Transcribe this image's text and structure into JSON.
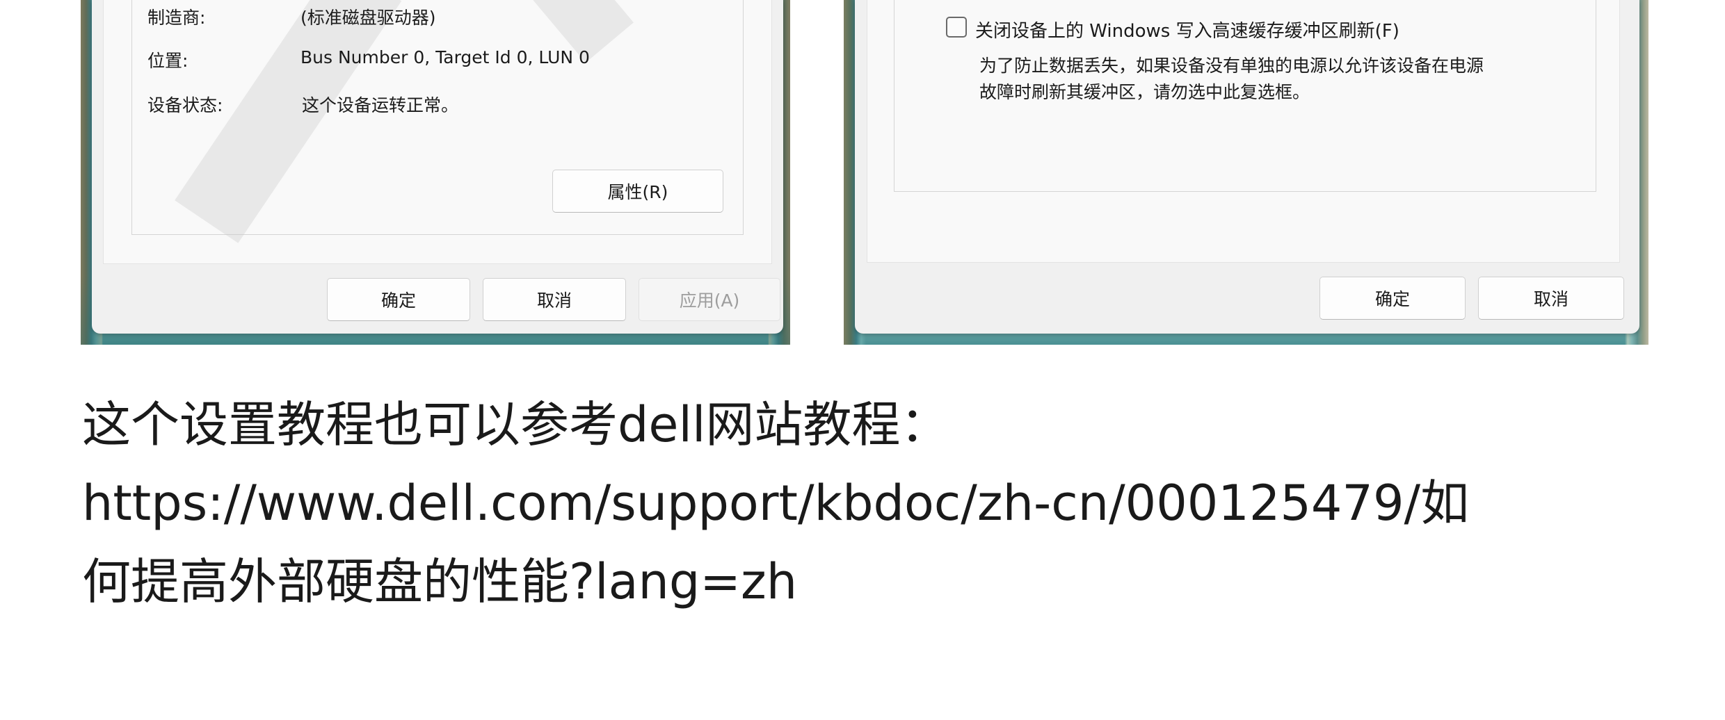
{
  "left_dialog": {
    "rows": [
      {
        "label": "制造商:",
        "value": "(标准磁盘驱动器)"
      },
      {
        "label": "位置:",
        "value": "Bus Number 0, Target Id 0, LUN 0"
      },
      {
        "label": "设备状态:",
        "value": "这个设备运转正常。"
      }
    ],
    "properties_button": "属性(R)",
    "ok_button": "确定",
    "cancel_button": "取消",
    "apply_button": "应用(A)"
  },
  "right_dialog": {
    "checkbox_label": "关闭设备上的 Windows 写入高速缓存缓冲区刷新(F)",
    "checkbox_checked": false,
    "description_lines": [
      "为了防止数据丢失，如果设备没有单独的电源以允许该设备在电源",
      "故障时刷新其缓冲区，请勿选中此复选框。"
    ],
    "ok_button": "确定",
    "cancel_button": "取消"
  },
  "caption": {
    "lines": [
      "这个设置教程也可以参考dell网站教程：",
      "https://www.dell.com/support/kbdoc/zh-cn/000125479/如",
      "何提高外部硬盘的性能?lang=zh"
    ]
  }
}
